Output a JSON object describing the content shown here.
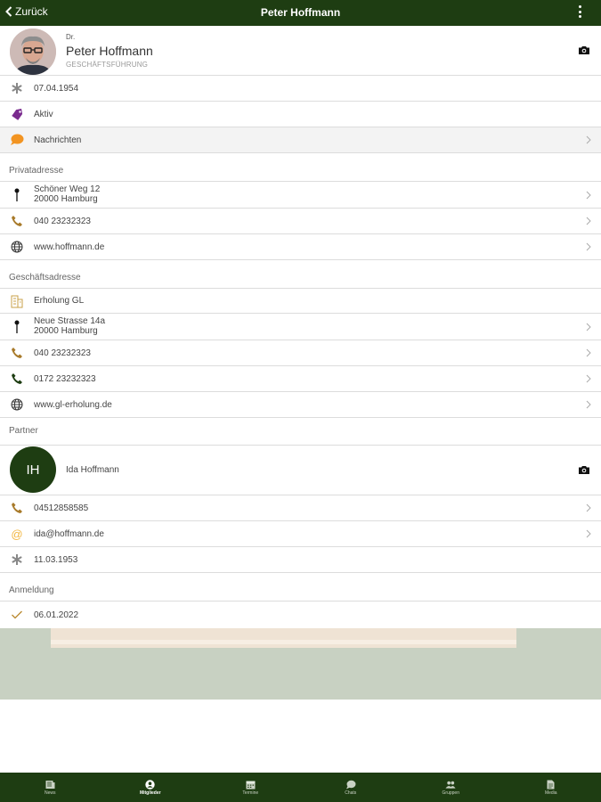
{
  "header": {
    "back_label": "Zurück",
    "title": "Peter Hoffmann"
  },
  "profile": {
    "prefix": "Dr.",
    "name": "Peter Hoffmann",
    "role": "GESCHÄFTSFÜHRUNG"
  },
  "info": {
    "birthday": "07.04.1954",
    "status": "Aktiv",
    "messages": "Nachrichten"
  },
  "private": {
    "section_label": "Privatadresse",
    "street": "Schöner Weg 12",
    "city": "20000 Hamburg",
    "phone": "040 23232323",
    "web": "www.hoffmann.de"
  },
  "business": {
    "section_label": "Geschäftsadresse",
    "company": "Erholung GL",
    "street": "Neue Strasse 14a",
    "city": "20000 Hamburg",
    "phone": "040 23232323",
    "mobile": "0172 23232323",
    "web": "www.gl-erholung.de"
  },
  "partner": {
    "section_label": "Partner",
    "initials": "IH",
    "name": "Ida Hoffmann",
    "phone": "04512858585",
    "email": "ida@hoffmann.de",
    "birthday": "11.03.1953"
  },
  "registration": {
    "section_label": "Anmeldung",
    "date": "06.01.2022"
  },
  "tabs": [
    {
      "label": "News",
      "icon": "news-icon"
    },
    {
      "label": "Mitglieder",
      "icon": "members-icon",
      "active": true
    },
    {
      "label": "Termine",
      "icon": "calendar-icon"
    },
    {
      "label": "Chats",
      "icon": "chat-icon"
    },
    {
      "label": "Gruppen",
      "icon": "groups-icon"
    },
    {
      "label": "Media",
      "icon": "document-icon"
    }
  ],
  "colors": {
    "brand": "#1e3d12",
    "accent_purple": "#7a2b8e",
    "accent_orange": "#f29422",
    "phone_brown": "#a87a2a"
  }
}
